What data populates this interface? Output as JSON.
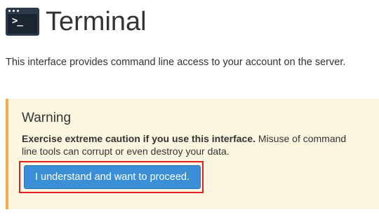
{
  "header": {
    "title": "Terminal",
    "icon": "terminal-icon",
    "icon_prompt": ">_"
  },
  "description": "This interface provides command line access to your account on the server.",
  "warning": {
    "title": "Warning",
    "bold_text": "Exercise extreme caution if you use this interface.",
    "text": " Misuse of command line tools can corrupt or even destroy your data.",
    "button_label": "I understand and want to proceed."
  },
  "colors": {
    "alert_background": "#fcf6e1",
    "alert_border": "#f0ad4e",
    "button": "#3a8fd6",
    "highlight": "#e02020"
  }
}
